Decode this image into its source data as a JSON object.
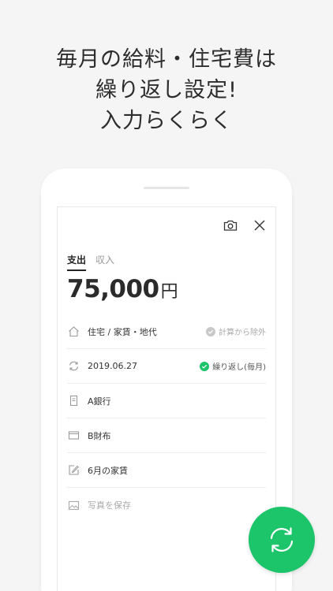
{
  "headline": {
    "line1": "毎月の給料・住宅費は",
    "line2": "繰り返し設定!",
    "line3": "入力らくらく"
  },
  "form": {
    "tabs": [
      {
        "label": "支出",
        "active": true
      },
      {
        "label": "収入",
        "active": false
      }
    ],
    "amount": {
      "value": "75,000",
      "unit": "円"
    },
    "rows": [
      {
        "icon": "house-icon",
        "label": "住宅 / 家賃・地代",
        "side": "計算から除外"
      },
      {
        "icon": "repeat-icon",
        "label": "2019.06.27",
        "side": "繰り返し(毎月)"
      },
      {
        "icon": "bank-icon",
        "label": "A銀行"
      },
      {
        "icon": "wallet-icon",
        "label": "B財布"
      },
      {
        "icon": "memo-icon",
        "label": "6月の家賃"
      },
      {
        "icon": "image-icon",
        "label": "写真を保存"
      }
    ]
  },
  "colors": {
    "accent": "#1cc46a",
    "check_inactive": "#c8c8c8"
  }
}
